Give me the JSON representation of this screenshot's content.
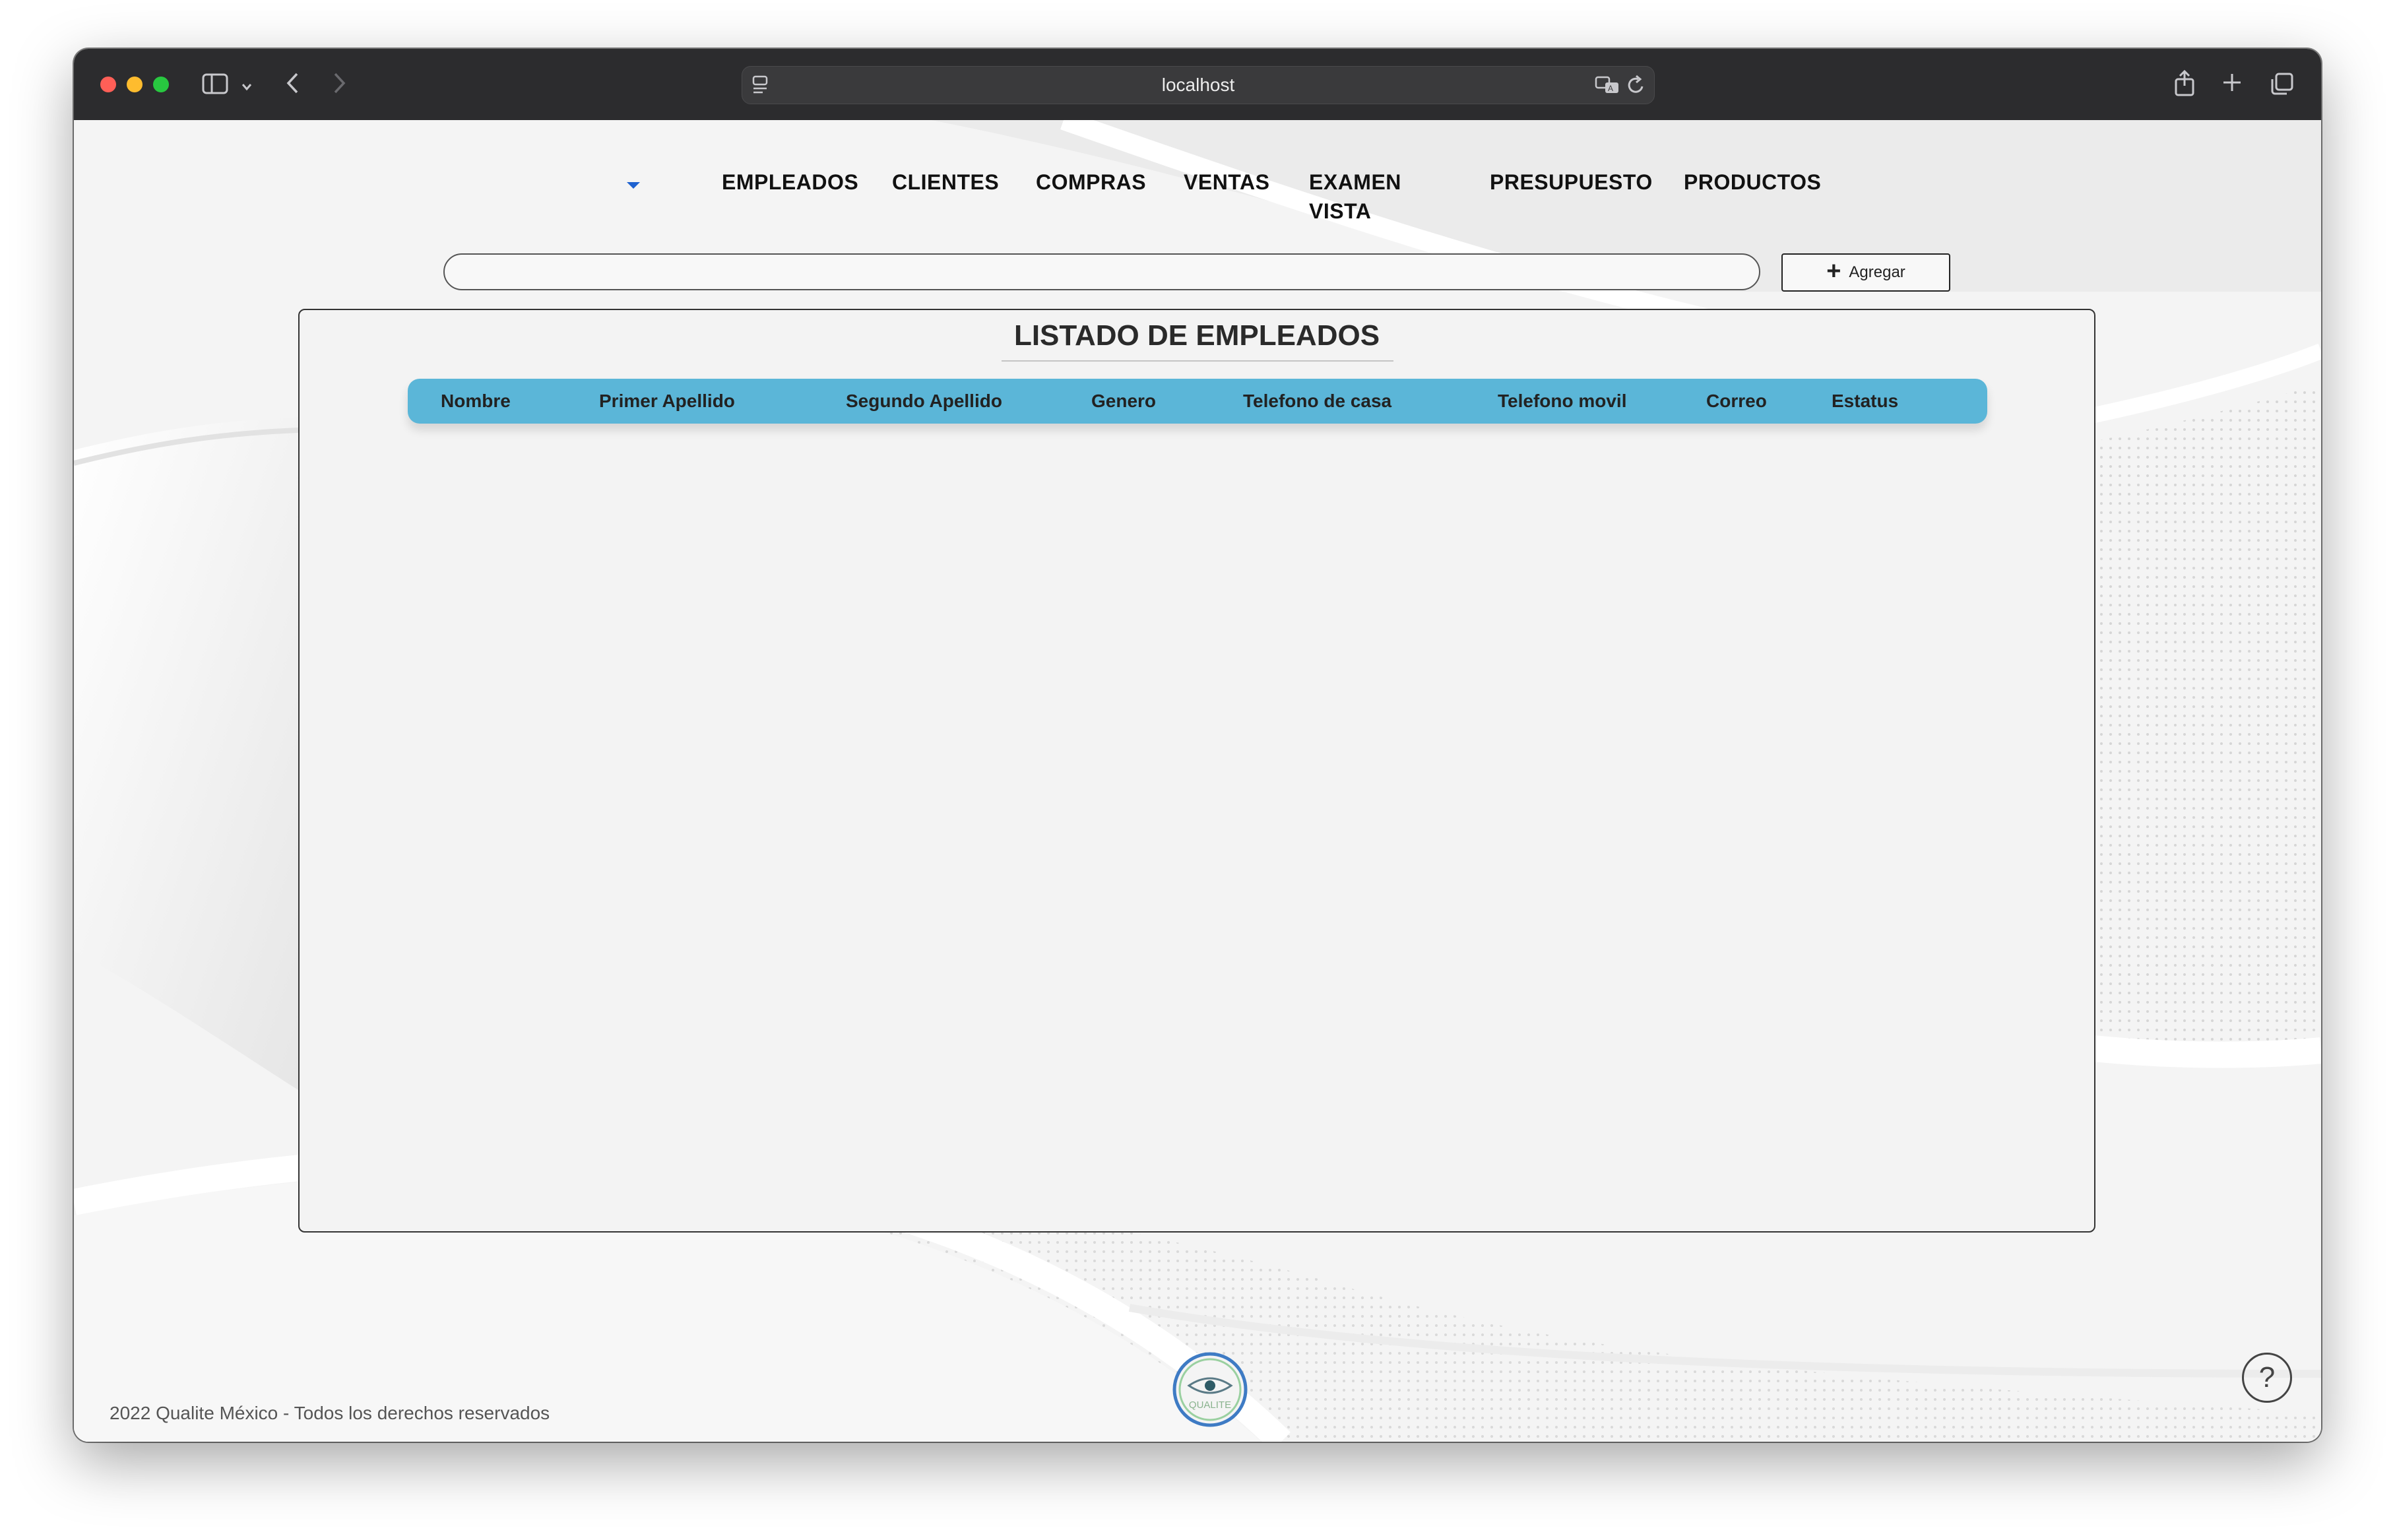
{
  "browser": {
    "url": "localhost",
    "icons": {
      "sidebar": "sidebar-icon",
      "back": "chevron-left-icon",
      "forward": "chevron-right-icon",
      "share": "share-icon",
      "new_tab": "plus-icon",
      "tabs": "tabs-overview-icon",
      "translate": "translate-icon",
      "reload": "reload-icon"
    }
  },
  "nav": {
    "items": [
      {
        "label": "EMPLEADOS"
      },
      {
        "label": "CLIENTES"
      },
      {
        "label": "COMPRAS"
      },
      {
        "label": "VENTAS"
      },
      {
        "label": "EXAMEN\nVISTA"
      },
      {
        "label": "PRESUPUESTO"
      },
      {
        "label": "PRODUCTOS"
      }
    ]
  },
  "search": {
    "value": "",
    "placeholder": ""
  },
  "toolbar": {
    "add_label": "Agregar"
  },
  "panel": {
    "title": "LISTADO DE EMPLEADOS",
    "columns": [
      "Nombre",
      "Primer Apellido",
      "Segundo Apellido",
      "Genero",
      "Telefono de casa",
      "Telefono movil",
      "Correo",
      "Estatus"
    ],
    "rows": []
  },
  "footer": {
    "copyright": "2022 Qualite México - Todos los derechos reservados",
    "logo_text": "QUALITE",
    "help_label": "?"
  },
  "colors": {
    "table_header": "#5bb6d8",
    "titlebar": "#2c2c2e",
    "nav_caret": "#1e62d0"
  }
}
